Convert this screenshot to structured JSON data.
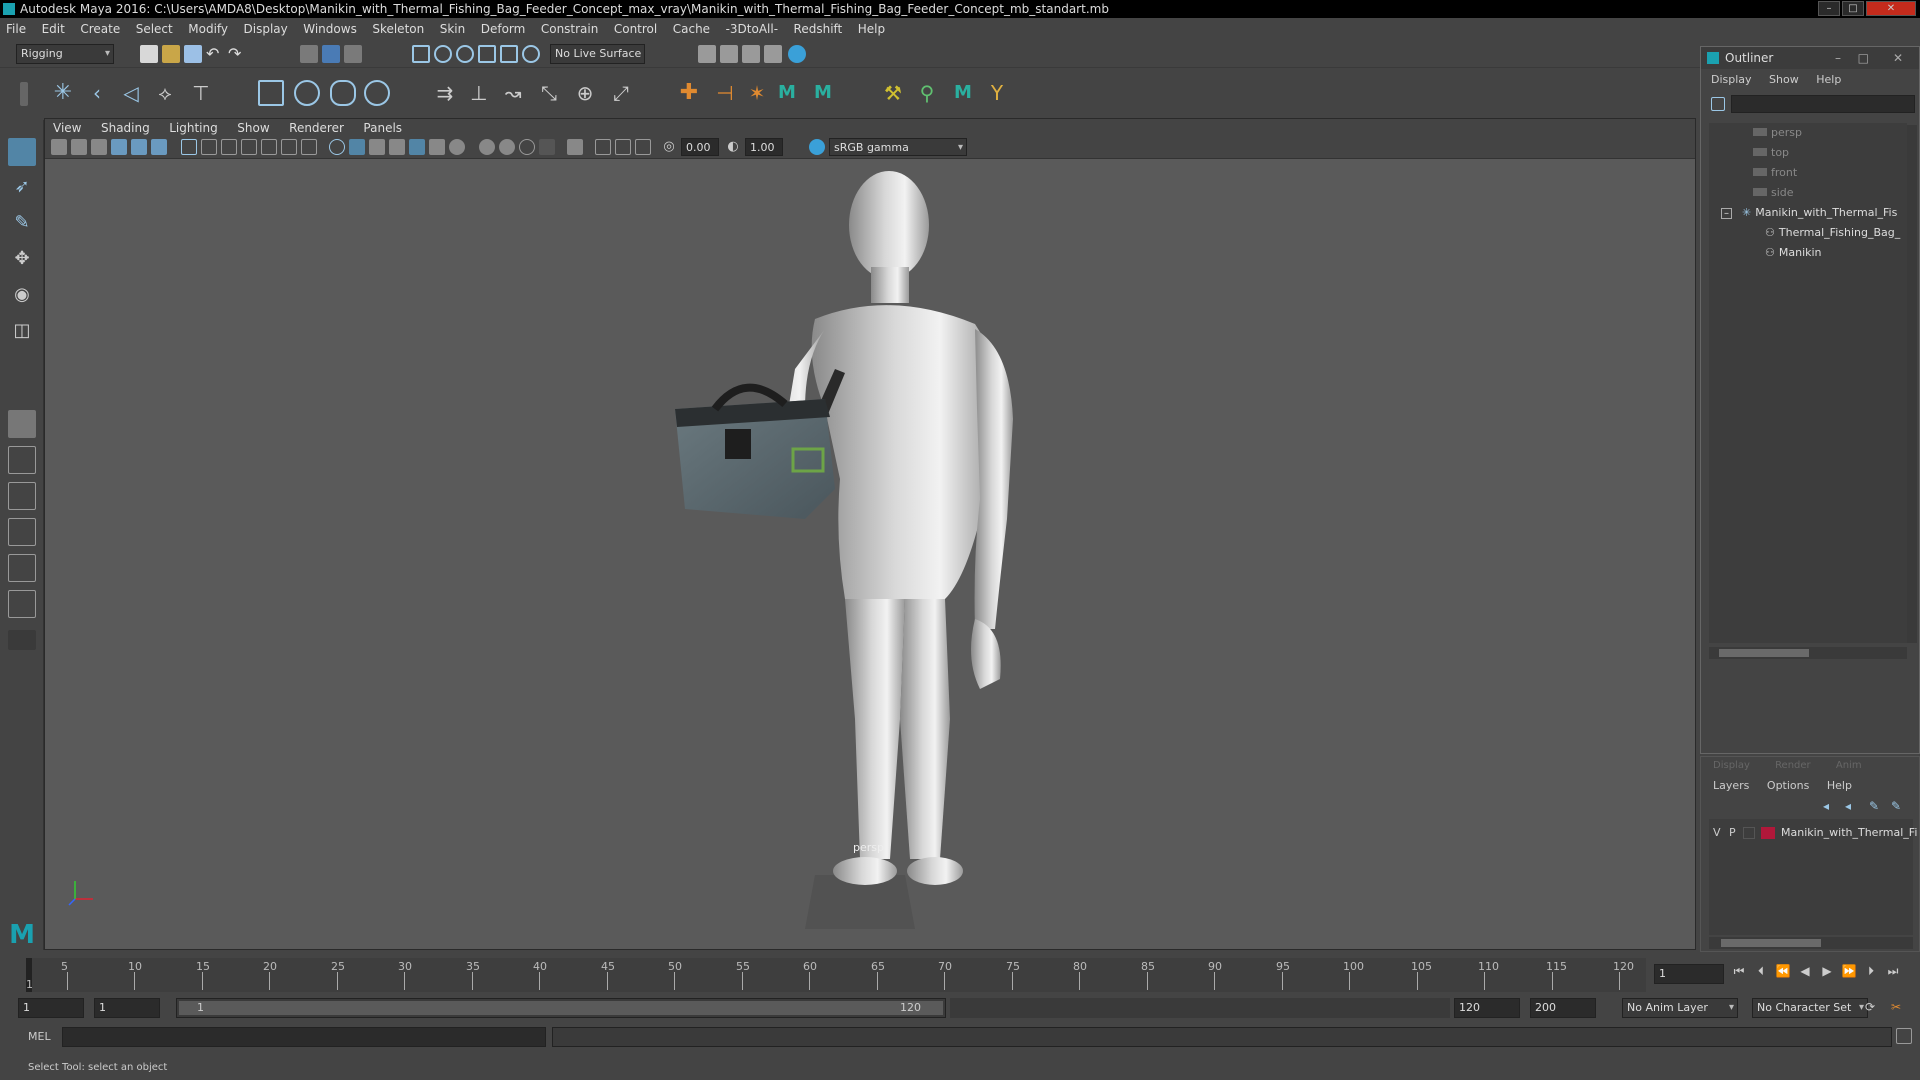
{
  "window": {
    "title": "Autodesk Maya 2016: C:\\Users\\AMDA8\\Desktop\\Manikin_with_Thermal_Fishing_Bag_Feeder_Concept_max_vray\\Manikin_with_Thermal_Fishing_Bag_Feeder_Concept_mb_standart.mb",
    "minimize": "–",
    "maximize": "□",
    "close": "✕"
  },
  "menu": [
    "File",
    "Edit",
    "Create",
    "Select",
    "Modify",
    "Display",
    "Windows",
    "Skeleton",
    "Skin",
    "Deform",
    "Constrain",
    "Control",
    "Cache",
    "-3DtoAll-",
    "Redshift",
    "Help"
  ],
  "status": {
    "menuset": "Rigging",
    "live_surface": "No Live Surface"
  },
  "viewport": {
    "menu": [
      "View",
      "Shading",
      "Lighting",
      "Show",
      "Renderer",
      "Panels"
    ],
    "exposure": "0.00",
    "gamma": "1.00",
    "colorspace": "sRGB gamma",
    "camera_label": "persp"
  },
  "outliner": {
    "title": "Outliner",
    "menu": [
      "Display",
      "Show",
      "Help"
    ],
    "items": [
      {
        "label": "persp",
        "kind": "camera"
      },
      {
        "label": "top",
        "kind": "camera"
      },
      {
        "label": "front",
        "kind": "camera"
      },
      {
        "label": "side",
        "kind": "camera"
      },
      {
        "label": "Manikin_with_Thermal_Fis",
        "kind": "group"
      },
      {
        "label": "Thermal_Fishing_Bag_",
        "kind": "mesh"
      },
      {
        "label": "Manikin",
        "kind": "mesh"
      }
    ]
  },
  "layers": {
    "tabs": [
      "Display",
      "Render",
      "Anim"
    ],
    "menu": [
      "Layers",
      "Options",
      "Help"
    ],
    "row": {
      "v": "V",
      "p": "P",
      "name": "Manikin_with_Thermal_Fi",
      "color": "#b0183a"
    }
  },
  "timeline": {
    "ticks": [
      "5",
      "10",
      "15",
      "20",
      "25",
      "30",
      "35",
      "40",
      "45",
      "50",
      "55",
      "60",
      "65",
      "70",
      "75",
      "80",
      "85",
      "90",
      "95",
      "100",
      "105",
      "110",
      "115",
      "120"
    ],
    "current_frame": "1",
    "marker": "1"
  },
  "range": {
    "start": "1",
    "playback_start": "1",
    "slider_start": "1",
    "slider_end": "120",
    "playback_end": "120",
    "end": "200",
    "anim_layer": "No Anim Layer",
    "character_set": "No Character Set"
  },
  "command": {
    "lang": "MEL"
  },
  "help": {
    "text": "Select Tool: select an object"
  }
}
